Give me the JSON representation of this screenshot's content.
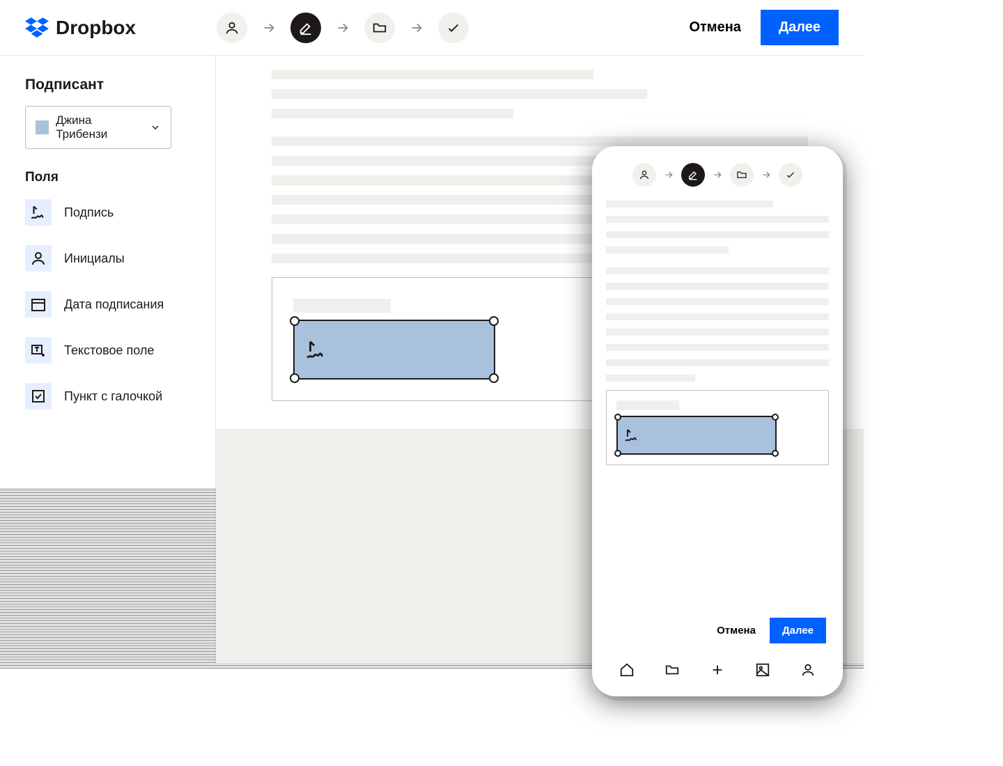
{
  "brand": "Dropbox",
  "header": {
    "cancel": "Отмена",
    "next": "Далее"
  },
  "sidebar": {
    "signer_label": "Подписант",
    "signer_name": "Джина Трибензи",
    "fields_label": "Поля",
    "fields": [
      {
        "label": "Подпись"
      },
      {
        "label": "Инициалы"
      },
      {
        "label": "Дата подписания"
      },
      {
        "label": "Текстовое поле"
      },
      {
        "label": "Пункт с галочкой"
      }
    ]
  },
  "mobile": {
    "cancel": "Отмена",
    "next": "Далее"
  },
  "colors": {
    "primary": "#0061ff",
    "signer": "#a8c2dd"
  }
}
